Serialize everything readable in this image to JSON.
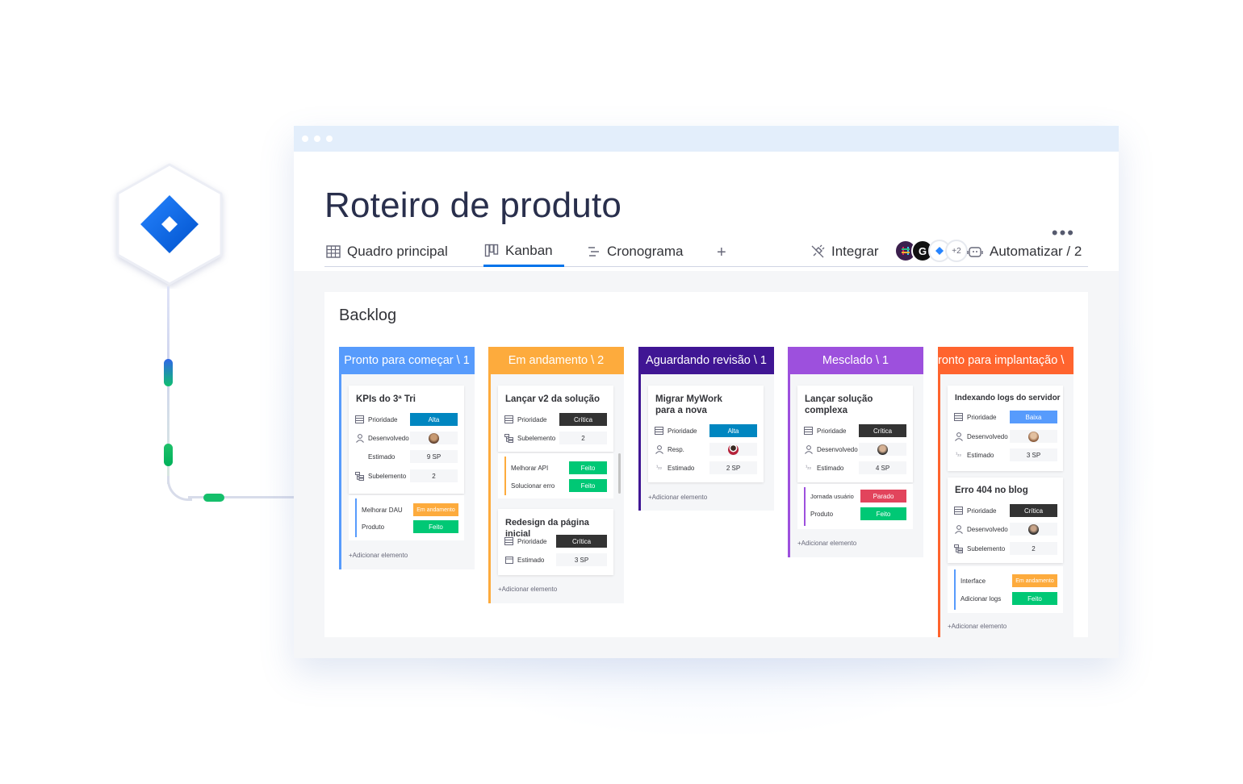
{
  "colors": {
    "blue_header": "#579bfc",
    "orange_header": "#fdab3d",
    "purple_dark_header": "#401694",
    "purple_header": "#9d50dd",
    "red_orange_header": "#ff642e",
    "status_alta": "#0086c0",
    "status_baixa": "#579bfc",
    "status_critica": "#333333",
    "status_feito": "#00c875",
    "status_andamento": "#fdab3d",
    "status_parado": "#e2445c"
  },
  "integration": {
    "icon": "jira-diamond-icon"
  },
  "window": {
    "title": "Roteiro de produto",
    "more_icon": "more-dots-icon",
    "tabs": [
      {
        "label": "Quadro principal",
        "icon": "table-icon"
      },
      {
        "label": "Kanban",
        "icon": "kanban-icon",
        "active": true
      },
      {
        "label": "Cronograma",
        "icon": "timeline-icon"
      }
    ],
    "add_tab": "+",
    "integrate_label": "Integrar",
    "integrate_badge": "+2",
    "automate_label": "Automatizar / 2"
  },
  "board": {
    "group_title": "Backlog",
    "columns": [
      {
        "header": "Pronto para começar \\ 1",
        "cards": [
          {
            "title": "KPIs do 3ª Tri",
            "fields": [
              {
                "label": "Prioridade",
                "value": "Alta"
              },
              {
                "label": "Desenvolvedo",
                "value": ""
              },
              {
                "label": "Estimado",
                "value": "9 SP"
              },
              {
                "label": "Subelemento",
                "value": "2"
              }
            ],
            "subitems": [
              {
                "label": "Melhorar DAU",
                "status": "Em andamento"
              },
              {
                "label": "Produto",
                "status": "Feito"
              }
            ]
          }
        ],
        "add": "+Adicionar elemento"
      },
      {
        "header": "Em andamento \\ 2",
        "cards": [
          {
            "title": "Lançar v2 da solução",
            "fields": [
              {
                "label": "Prioridade",
                "value": "Crítica"
              },
              {
                "label": "Subelemento",
                "value": "2"
              }
            ],
            "subitems": [
              {
                "label": "Melhorar API",
                "status": "Feito"
              },
              {
                "label": "Solucionar erro",
                "status": "Feito"
              }
            ]
          },
          {
            "title": "Redesign da página inicial",
            "fields": [
              {
                "label": "Prioridade",
                "value": "Crítica"
              },
              {
                "label": "Estimado",
                "value": "3 SP"
              }
            ]
          }
        ],
        "add": "+Adicionar elemento"
      },
      {
        "header": "Aguardando revisão \\ 1",
        "cards": [
          {
            "title": "Migrar MyWork para a nova",
            "fields": [
              {
                "label": "Prioridade",
                "value": "Alta"
              },
              {
                "label": "Resp.",
                "value": ""
              },
              {
                "label": "Estimado",
                "value": "2 SP"
              }
            ]
          }
        ],
        "add": "+Adicionar elemento"
      },
      {
        "header": "Mesclado \\ 1",
        "cards": [
          {
            "title": "Lançar solução complexa",
            "fields": [
              {
                "label": "Prioridade",
                "value": "Crítica"
              },
              {
                "label": "Desenvolvedo",
                "value": ""
              },
              {
                "label": "Estimado",
                "value": "4 SP"
              }
            ],
            "subitems": [
              {
                "label": "Jornada usuário",
                "status": "Parado"
              },
              {
                "label": "Produto",
                "status": "Feito"
              }
            ]
          }
        ],
        "add": "+Adicionar elemento"
      },
      {
        "header": "ronto para implantação \\",
        "cards": [
          {
            "title": "Indexando logs do servidor",
            "fields": [
              {
                "label": "Prioridade",
                "value": "Baixa"
              },
              {
                "label": "Desenvolvedo",
                "value": ""
              },
              {
                "label": "Estimado",
                "value": "3 SP"
              }
            ]
          },
          {
            "title": "Erro 404 no blog",
            "fields": [
              {
                "label": "Prioridade",
                "value": "Crítica"
              },
              {
                "label": "Desenvolvedo",
                "value": ""
              },
              {
                "label": "Subelemento",
                "value": "2"
              }
            ],
            "subitems": [
              {
                "label": "Interface",
                "status": "Em andamento"
              },
              {
                "label": "Adicionar logs",
                "status": "Feito"
              }
            ]
          }
        ],
        "add": "+Adicionar elemento"
      }
    ]
  }
}
